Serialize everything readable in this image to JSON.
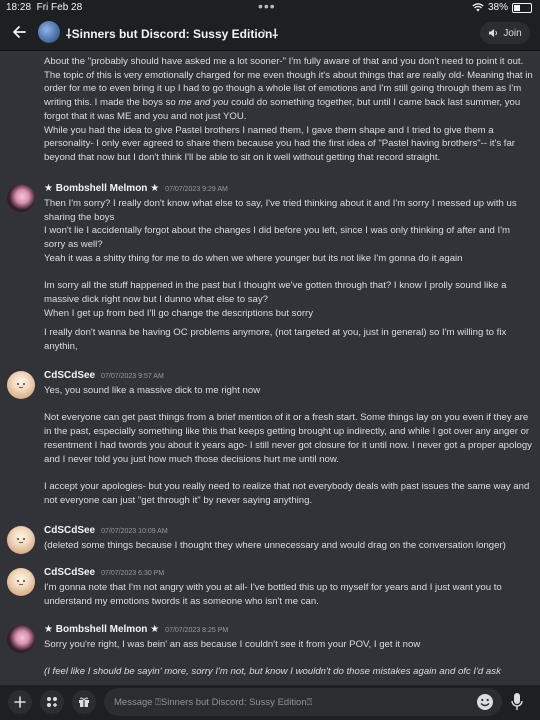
{
  "status_bar": {
    "time": "18:28",
    "date": "Fri Feb 28",
    "dots": "•••",
    "battery": "38%",
    "battery_level": 0.38
  },
  "header": {
    "channel_title": "⸸Sinners but Discord: Sussy Edition⸸",
    "chevron": "›",
    "join_label": "Join"
  },
  "continuation": [
    "About the \"probably should have asked me a lot sooner-\" I'm fully aware of that and you don't need to point it out. The topic of this is very emotionally charged for me even though it's about things that are really old- Meaning that in order for me to even bring it up I had to go though a whole list of emotions and I'm still going through them as I'm writing this. I made the boys so ",
    "me and you",
    " could do something together, but until I came back last summer, you forgot that it was ME and you and not just YOU.",
    "While you had the idea to give Pastel brothers I named them, I gave them shape and I tried to give them a personality- I only ever agreed to share them because you had the first idea of \"Pastel having brothers\"-- it's far beyond that now but I don't think I'll be able to sit on it well without getting that record straight."
  ],
  "messages": [
    {
      "author": "★ Bombshell Melmon ★",
      "timestamp": "07/07/2023 9:29 AM",
      "avatar": "avatar-bombshell",
      "paragraphs": [
        "Then I'm sorry? I really don't know what else to say, I've tried thinking about it and I'm sorry I messed up with us sharing the boys",
        "I won't lie I accidentally forgot about the changes I did before you left, since I was only thinking of after and I'm sorry as well?",
        "Yeah it was a shitty thing for me to do when we where younger but its not like I'm gonna do it again",
        "",
        "Im sorry all the stuff happened in the past but I thought we've gotten through that? I know I prolly sound like a massive dick right now but I dunno what else to say?",
        "When I get up from bed I'll go change the descriptions but sorry",
        "I really don't wanna be having OC problems anymore, (not targeted at you, just in general) so I'm willing to fix anythin,"
      ]
    },
    {
      "author": "CdSCdSee",
      "timestamp": "07/07/2023 9:57 AM",
      "avatar": "avatar-cdscdsee",
      "paragraphs": [
        "Yes, you sound like a massive dick to me right now",
        "",
        "Not everyone can get past things from a brief mention of it or a fresh start. Some things lay on you even if they are in the past, especially something like this that keeps getting brought up indirectly, and while I got over any anger or resentment I had twords you about it years ago- I still never got closure for it until now. I never got a proper apology and I never told you just how much those decisions hurt me until now.",
        "",
        "I accept your apologies- but you really need to realize that not everybody deals with past issues the same way and not everyone can just \"get through it\" by never saying anything."
      ]
    },
    {
      "author": "CdSCdSee",
      "timestamp": "07/07/2023 10:09 AM",
      "avatar": "avatar-cdscdsee",
      "paragraphs": [
        "(deleted some things because I thought they where unnecessary and would drag on the conversation longer)"
      ]
    },
    {
      "author": "CdSCdSee",
      "timestamp": "07/07/2023 6:30 PM",
      "avatar": "avatar-cdscdsee",
      "paragraphs": [
        "I'm gonna note that I'm not angry with you at all- I've bottled this up to myself for years and I just want you to understand my emotions twords it as someone who isn't me can."
      ]
    },
    {
      "author": "★ Bombshell Melmon ★",
      "timestamp": "07/07/2023 8:25 PM",
      "avatar": "avatar-bombshell",
      "paragraphs": [
        "Sorry you're right, I was bein' an ass because I couldn't see it from your POV, I get it now",
        "",
        "(I feel like I should be sayin' more, sorry I'm not, but know I wouldn't do those mistakes again and ofc I'd ask"
      ]
    }
  ],
  "composer": {
    "placeholder": "Message ⍰Sinners but Discord: Sussy Edition⍰"
  },
  "colors": {
    "background": "#313338",
    "bar": "#1e1f22",
    "text": "#dbdee1",
    "muted": "#949ba4"
  }
}
